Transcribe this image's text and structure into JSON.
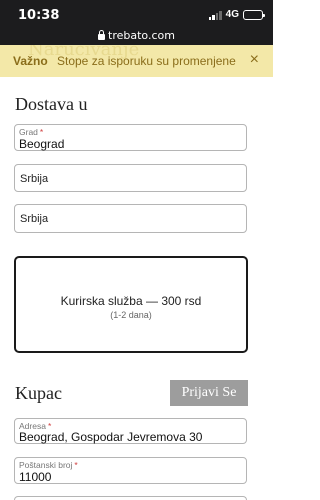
{
  "status_bar": {
    "time": "10:38",
    "network": "4G"
  },
  "browser": {
    "url": "trebato.com"
  },
  "notice": {
    "ghost_text": "Naručivanje",
    "title": "Važno",
    "text": "Stope za isporuku su promenjene",
    "close": "×"
  },
  "delivery": {
    "heading": "Dostava u",
    "city": {
      "label": "Grad",
      "required": "*",
      "value": "Beograd"
    },
    "country": "Srbija",
    "region": "Srbija",
    "shipping_option": {
      "title": "Kurirska služba — 300 rsd",
      "subtitle": "(1-2 dana)"
    }
  },
  "buyer": {
    "heading": "Kupac",
    "login_button": "Prijavi Se",
    "address": {
      "label": "Adresa",
      "required": "*",
      "value": "Beograd, Gospodar Jevremova 30"
    },
    "postal": {
      "label": "Poštanski broj",
      "required": "*",
      "value": "11000"
    }
  }
}
